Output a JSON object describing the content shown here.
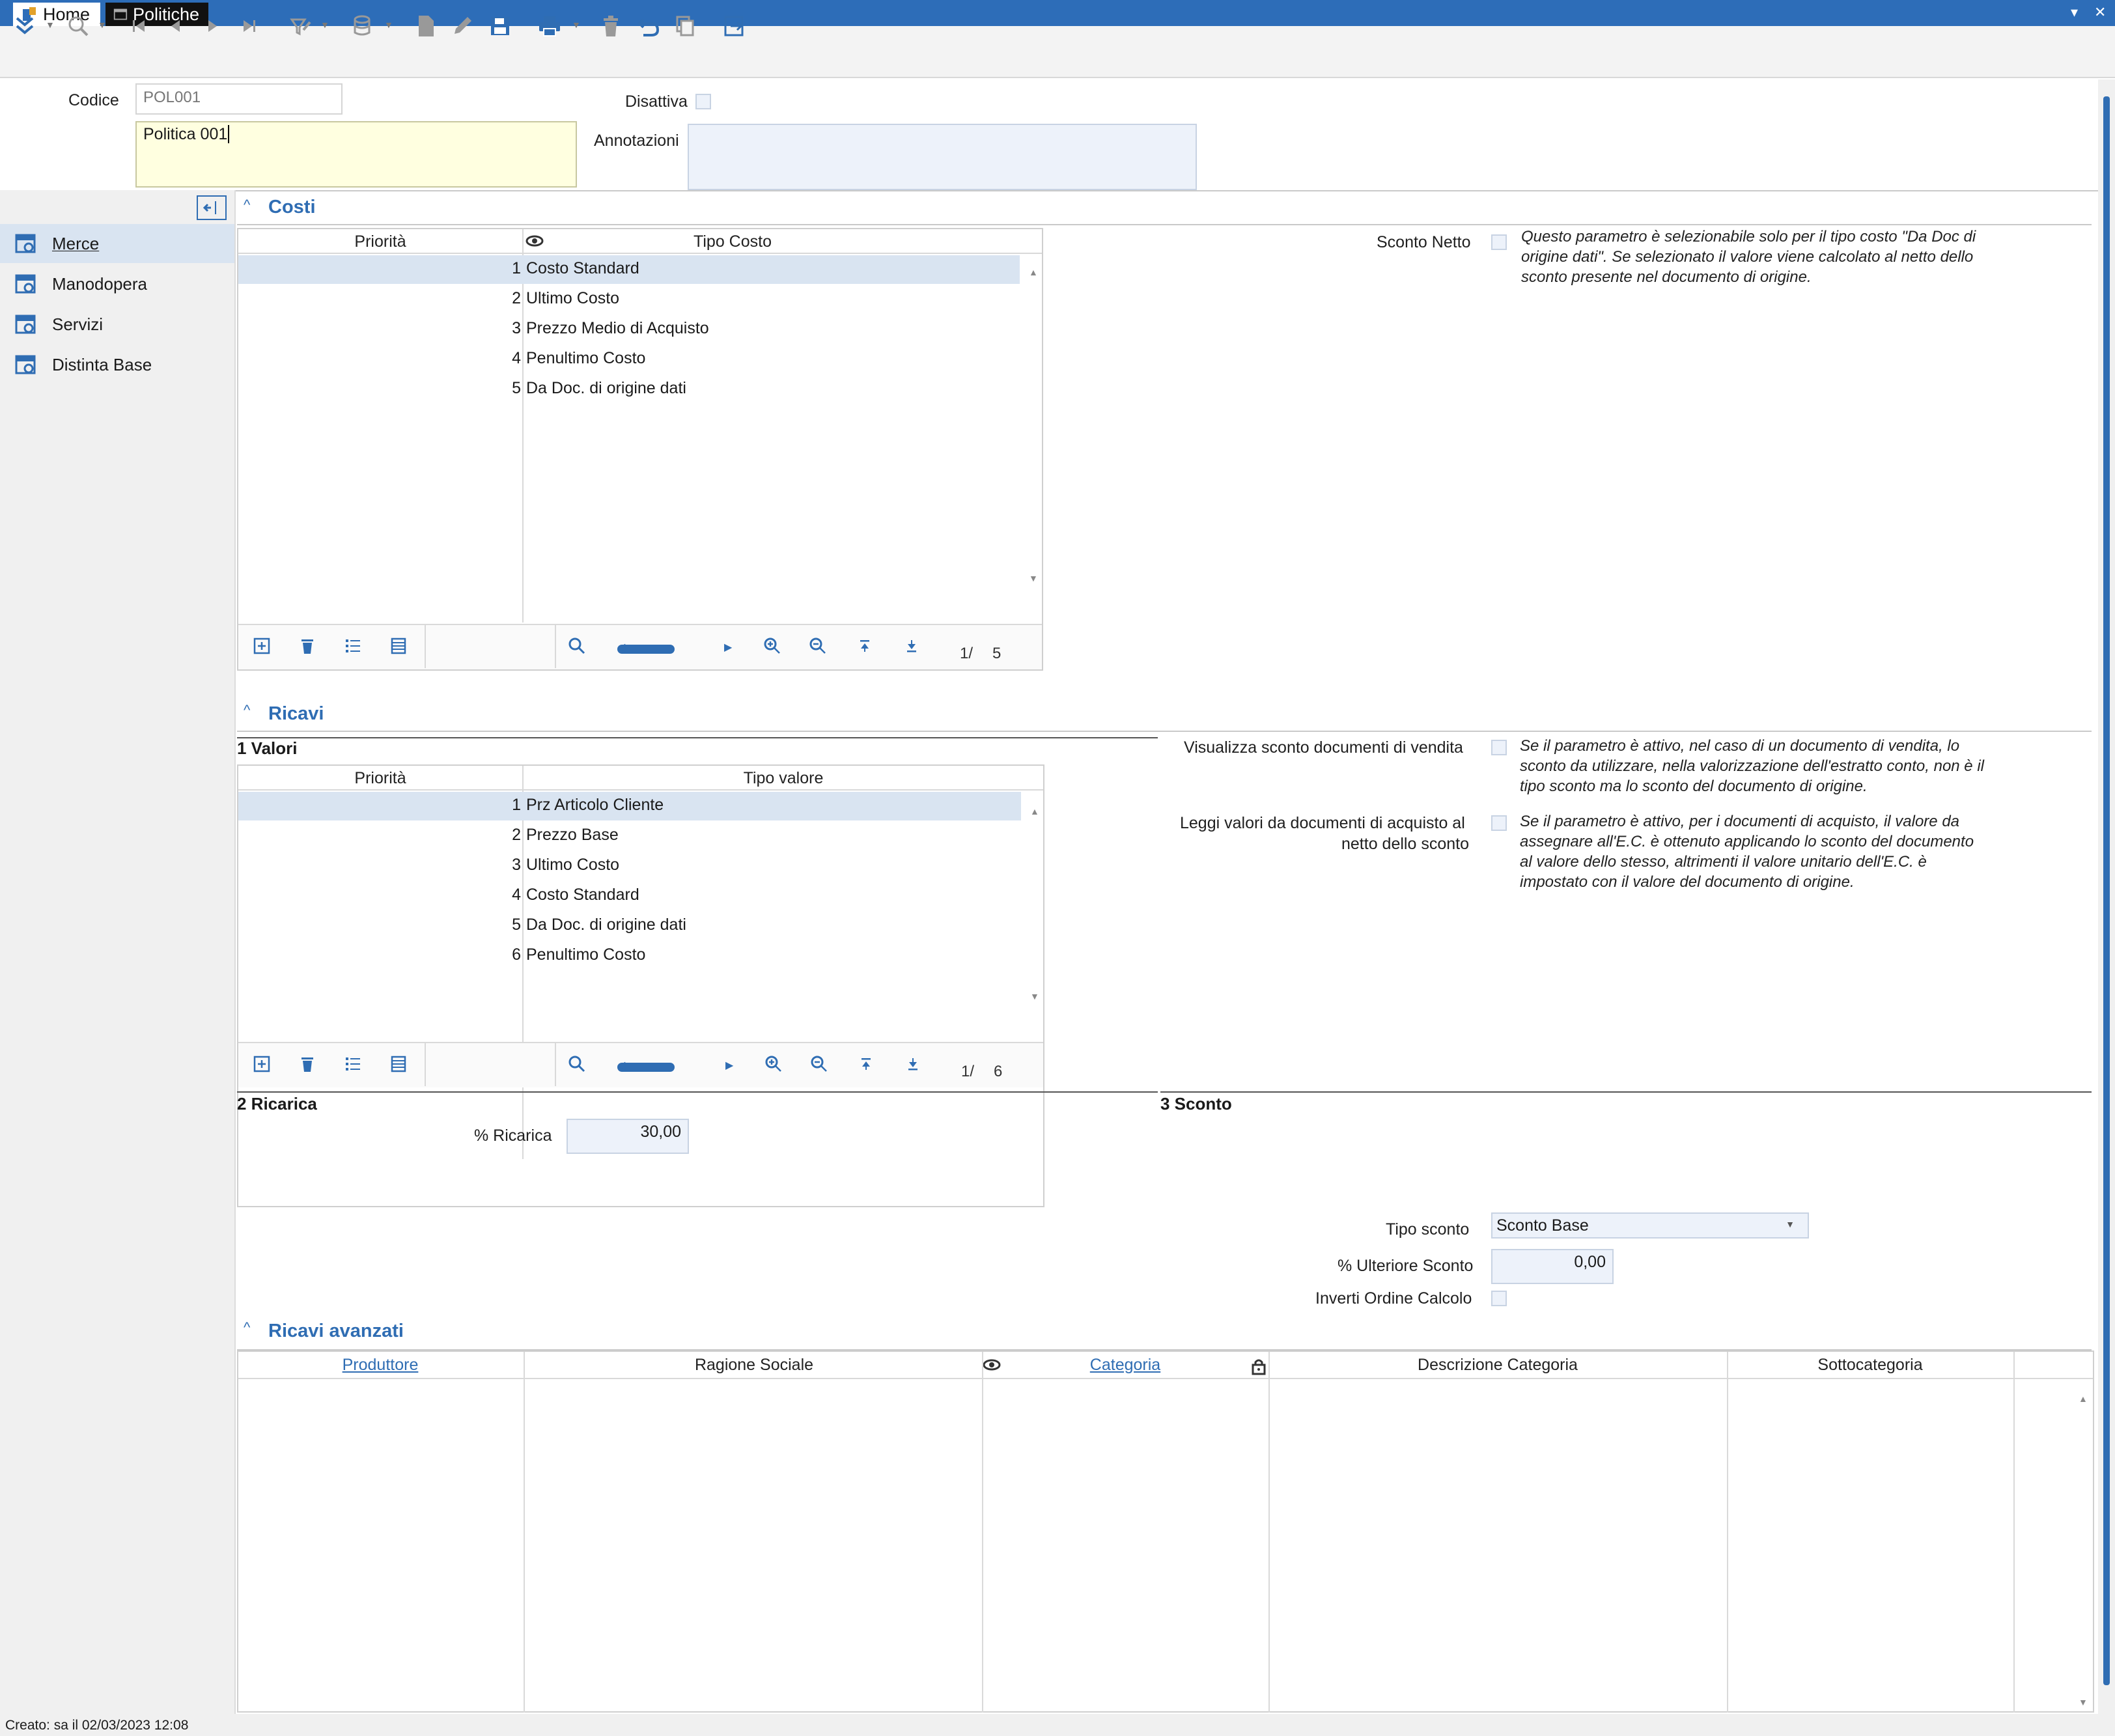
{
  "tabs": [
    {
      "label": "Home"
    },
    {
      "label": "Politiche"
    }
  ],
  "window_controls": {
    "minimize": "▾",
    "close": "✕"
  },
  "header": {
    "codice_label": "Codice",
    "codice_value": "POL001",
    "descrizione_value": "Politica 001",
    "disattiva_label": "Disattiva",
    "annotazioni_label": "Annotazioni"
  },
  "sidebar": {
    "items": [
      {
        "label": "Merce"
      },
      {
        "label": "Manodopera"
      },
      {
        "label": "Servizi"
      },
      {
        "label": "Distinta Base"
      }
    ]
  },
  "costi": {
    "title": "Costi",
    "columns": [
      "Priorità",
      "Tipo Costo"
    ],
    "rows": [
      {
        "n": "1",
        "v": "Costo Standard"
      },
      {
        "n": "2",
        "v": "Ultimo Costo"
      },
      {
        "n": "3",
        "v": "Prezzo Medio di Acquisto"
      },
      {
        "n": "4",
        "v": "Penultimo Costo"
      },
      {
        "n": "5",
        "v": "Da Doc. di origine dati"
      }
    ],
    "pager_current": "1/",
    "pager_total": "5",
    "sconto_netto_label": "Sconto Netto",
    "sconto_netto_note": "Questo parametro è selezionabile solo per il tipo costo \"Da Doc di origine dati\". Se selezionato il valore viene calcolato al netto dello sconto presente nel documento di origine."
  },
  "ricavi": {
    "title": "Ricavi",
    "valori_title": "1 Valori",
    "columns": [
      "Priorità",
      "Tipo valore"
    ],
    "rows": [
      {
        "n": "1",
        "v": "Prz Articolo Cliente"
      },
      {
        "n": "2",
        "v": "Prezzo Base"
      },
      {
        "n": "3",
        "v": "Ultimo Costo"
      },
      {
        "n": "4",
        "v": "Costo Standard"
      },
      {
        "n": "5",
        "v": "Da Doc. di origine dati"
      },
      {
        "n": "6",
        "v": "Penultimo Costo"
      }
    ],
    "pager_current": "1/",
    "pager_total": "6",
    "vis_sconto_label": "Visualizza sconto documenti di vendita",
    "vis_sconto_note": "Se il parametro è attivo, nel caso di un documento di vendita, lo sconto da utilizzare, nella valorizzazione dell'estratto conto, non è il tipo sconto ma lo sconto del documento di origine.",
    "leggi_label_1": "Leggi valori da documenti di acquisto al",
    "leggi_label_2": "netto dello sconto",
    "leggi_note": "Se il parametro è attivo, per i documenti di acquisto, il valore da assegnare all'E.C. è ottenuto applicando lo sconto del documento al valore dello stesso, altrimenti il valore unitario dell'E.C. è impostato con il valore del documento di origine.",
    "ricarica_title": "2 Ricarica",
    "ricarica_label": "% Ricarica",
    "ricarica_value": "30,00",
    "sconto_title": "3 Sconto",
    "tipo_sconto_label": "Tipo sconto",
    "tipo_sconto_value": "Sconto Base",
    "ulteriore_label": "% Ulteriore Sconto",
    "ulteriore_value": "0,00",
    "inverti_label": "Inverti Ordine Calcolo"
  },
  "ricavi_avanzati": {
    "title": "Ricavi avanzati",
    "columns": [
      "Produttore",
      "Ragione Sociale",
      "Categoria",
      "Descrizione Categoria",
      "Sottocategoria"
    ]
  },
  "status": {
    "text": "Creato: sa il 02/03/2023 12:08"
  },
  "colors": {
    "titlebar": "#2d6db8",
    "accent": "#2f6db3",
    "selection": "#d9e4f1",
    "input_bg": "#edf2fa",
    "memo_bg": "#ffffe0"
  }
}
